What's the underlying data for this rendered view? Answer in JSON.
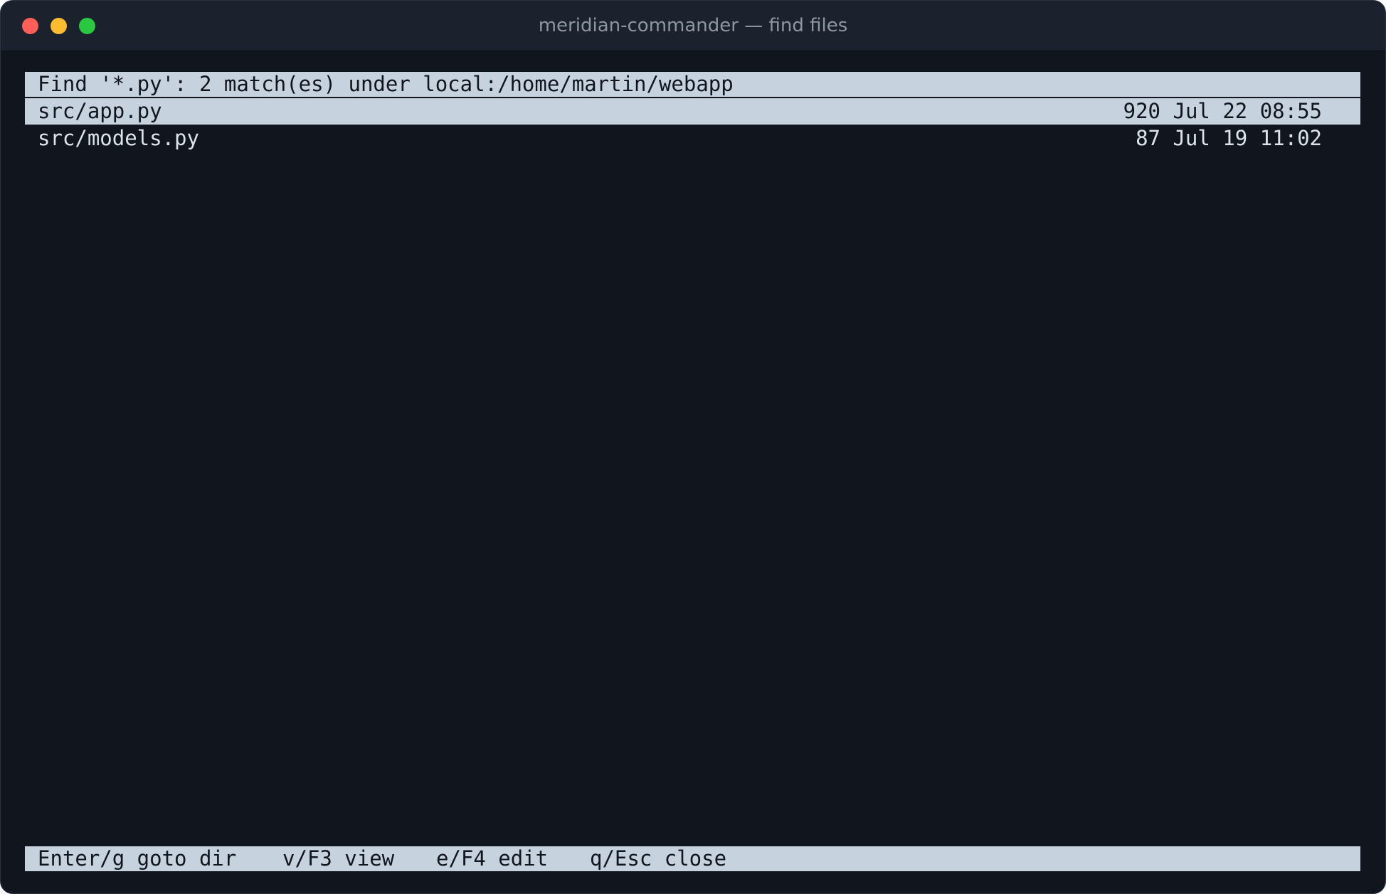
{
  "window": {
    "title": "meridian-commander — find files"
  },
  "colors": {
    "close": "#ff5f57",
    "minimize": "#febc2e",
    "zoom": "#28c840",
    "background": "#11151e",
    "highlight": "#c6d3df"
  },
  "results": {
    "header": "Find '*.py': 2 match(es) under local:/home/martin/webapp",
    "rows": [
      {
        "name": "src/app.py",
        "info": "920 Jul 22 08:55",
        "selected": true
      },
      {
        "name": "src/models.py",
        "info": "87 Jul 19 11:02",
        "selected": false
      }
    ]
  },
  "status": {
    "hints": [
      "Enter/g goto dir",
      "v/F3 view",
      "e/F4 edit",
      "q/Esc close"
    ]
  }
}
